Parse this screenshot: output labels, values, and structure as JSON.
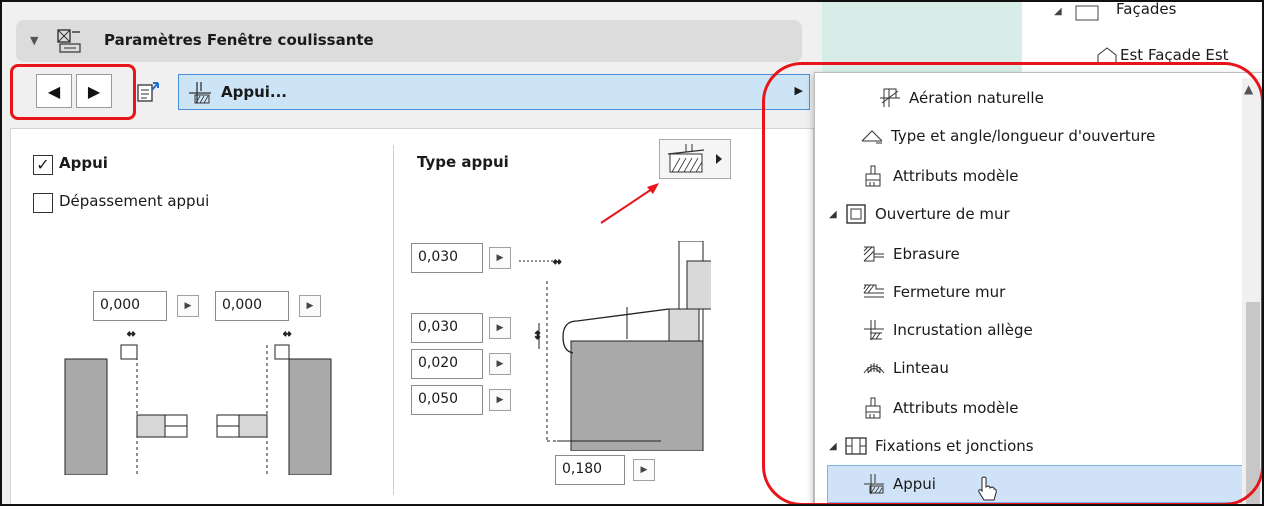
{
  "panel": {
    "title": "Paramètres Fenêtre coulissante",
    "selector_label": "Appui...",
    "appui_label": "Appui",
    "appui_checked": true,
    "depassement_label": "Dépassement appui",
    "depassement_checked": false,
    "type_label": "Type appui",
    "values": {
      "left_a": "0,000",
      "left_b": "0,000",
      "v1": "0,030",
      "v2": "0,030",
      "v3": "0,020",
      "v4": "0,050",
      "bottom": "0,180"
    }
  },
  "tree": {
    "facades": "Façades",
    "est": "Est Façade Est"
  },
  "menu": {
    "items": [
      {
        "label": "Aération naturelle",
        "icon": "ventilation-icon"
      },
      {
        "label": "Type et angle/longueur d'ouverture",
        "icon": "opening-angle-icon"
      },
      {
        "label": "Attributs modèle",
        "icon": "brush-icon"
      },
      {
        "label": "Ouverture de mur",
        "icon": "wall-opening-icon"
      },
      {
        "label": "Ebrasure",
        "icon": "reveal-icon"
      },
      {
        "label": "Fermeture mur",
        "icon": "wall-closure-icon"
      },
      {
        "label": "Incrustation allège",
        "icon": "parapet-inset-icon"
      },
      {
        "label": "Linteau",
        "icon": "lintel-icon"
      },
      {
        "label": "Attributs modèle",
        "icon": "brush-icon"
      },
      {
        "label": "Fixations et jonctions",
        "icon": "fixings-icon"
      },
      {
        "label": "Appui",
        "icon": "sill-icon"
      }
    ]
  },
  "colors": {
    "highlight_red": "#e8141a",
    "selection_blue": "#cfe2f7"
  }
}
